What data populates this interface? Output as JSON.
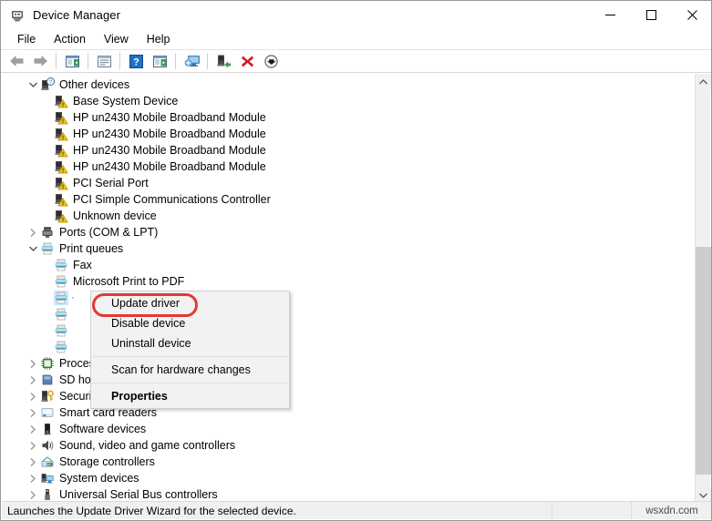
{
  "window": {
    "title": "Device Manager",
    "icon": "device-manager-icon",
    "buttons": {
      "minimize": "—",
      "maximize": "□",
      "close": "✕"
    }
  },
  "menubar": {
    "items": [
      {
        "label": "File",
        "name": "menu-file"
      },
      {
        "label": "Action",
        "name": "menu-action"
      },
      {
        "label": "View",
        "name": "menu-view"
      },
      {
        "label": "Help",
        "name": "menu-help"
      }
    ]
  },
  "toolbar": {
    "buttons": [
      {
        "name": "back-button",
        "icon": "back-arrow-icon",
        "title": "Back"
      },
      {
        "name": "forward-button",
        "icon": "forward-arrow-icon",
        "title": "Forward"
      },
      {
        "name": "show-hide-console-tree-button",
        "icon": "console-tree-icon",
        "title": "Show/Hide Console Tree"
      },
      {
        "name": "properties-button",
        "icon": "properties-window-icon",
        "title": "Properties"
      },
      {
        "name": "help-button",
        "icon": "question-mark-icon",
        "title": "Help"
      },
      {
        "name": "action-pane-button",
        "icon": "action-pane-icon",
        "title": "Show Action Pane"
      },
      {
        "name": "scan-hardware-changes-button",
        "icon": "scan-monitor-icon",
        "title": "Scan for hardware changes"
      },
      {
        "name": "update-driver-button",
        "icon": "update-driver-icon",
        "title": "Update driver"
      },
      {
        "name": "uninstall-device-button",
        "icon": "red-x-icon",
        "title": "Uninstall device"
      },
      {
        "name": "disable-device-button",
        "icon": "down-arrow-circle-icon",
        "title": "Disable device"
      }
    ]
  },
  "tree": {
    "rows": [
      {
        "label": "Other devices",
        "level": 0,
        "expander": "expanded",
        "icon": "unknown-device-category-icon",
        "selected": false
      },
      {
        "label": "Base System Device",
        "level": 1,
        "expander": "none",
        "icon": "warning-device-icon",
        "selected": false
      },
      {
        "label": "HP un2430 Mobile Broadband Module",
        "level": 1,
        "expander": "none",
        "icon": "warning-device-icon",
        "selected": false
      },
      {
        "label": "HP un2430 Mobile Broadband Module",
        "level": 1,
        "expander": "none",
        "icon": "warning-device-icon",
        "selected": false
      },
      {
        "label": "HP un2430 Mobile Broadband Module",
        "level": 1,
        "expander": "none",
        "icon": "warning-device-icon",
        "selected": false
      },
      {
        "label": "HP un2430 Mobile Broadband Module",
        "level": 1,
        "expander": "none",
        "icon": "warning-device-icon",
        "selected": false
      },
      {
        "label": "PCI Serial Port",
        "level": 1,
        "expander": "none",
        "icon": "warning-device-icon",
        "selected": false
      },
      {
        "label": "PCI Simple Communications Controller",
        "level": 1,
        "expander": "none",
        "icon": "warning-device-icon",
        "selected": false
      },
      {
        "label": "Unknown device",
        "level": 1,
        "expander": "none",
        "icon": "warning-device-icon",
        "selected": false
      },
      {
        "label": "Ports (COM & LPT)",
        "level": 0,
        "expander": "collapsed",
        "icon": "port-icon",
        "selected": false
      },
      {
        "label": "Print queues",
        "level": 0,
        "expander": "expanded",
        "icon": "printer-icon",
        "selected": false
      },
      {
        "label": "Fax",
        "level": 1,
        "expander": "none",
        "icon": "printer-icon",
        "selected": false
      },
      {
        "label": "Microsoft Print to PDF",
        "level": 1,
        "expander": "none",
        "icon": "printer-icon",
        "selected": false
      },
      {
        "label": "",
        "level": 1,
        "expander": "none",
        "icon": "printer-icon",
        "selected": true
      },
      {
        "label": "",
        "level": 1,
        "expander": "none",
        "icon": "printer-icon",
        "selected": false
      },
      {
        "label": "",
        "level": 1,
        "expander": "none",
        "icon": "printer-icon",
        "selected": false
      },
      {
        "label": "",
        "level": 1,
        "expander": "none",
        "icon": "printer-icon",
        "selected": false
      },
      {
        "label": "Processors",
        "level": 0,
        "expander": "collapsed",
        "icon": "processor-icon",
        "selected": false
      },
      {
        "label": "SD host adapters",
        "level": 0,
        "expander": "collapsed",
        "icon": "sd-host-icon",
        "selected": false
      },
      {
        "label": "Security devices",
        "level": 0,
        "expander": "collapsed",
        "icon": "security-device-icon",
        "selected": false
      },
      {
        "label": "Smart card readers",
        "level": 0,
        "expander": "collapsed",
        "icon": "smartcard-reader-icon",
        "selected": false
      },
      {
        "label": "Software devices",
        "level": 0,
        "expander": "collapsed",
        "icon": "software-device-icon",
        "selected": false
      },
      {
        "label": "Sound, video and game controllers",
        "level": 0,
        "expander": "collapsed",
        "icon": "speaker-icon",
        "selected": false
      },
      {
        "label": "Storage controllers",
        "level": 0,
        "expander": "collapsed",
        "icon": "storage-controller-icon",
        "selected": false
      },
      {
        "label": "System devices",
        "level": 0,
        "expander": "collapsed",
        "icon": "system-device-icon",
        "selected": false
      },
      {
        "label": "Universal Serial Bus controllers",
        "level": 0,
        "expander": "collapsed",
        "icon": "usb-icon",
        "selected": false
      }
    ]
  },
  "context_menu": {
    "items": [
      {
        "label": "Update driver",
        "name": "ctx-update-driver",
        "bold": false,
        "separator_after": false,
        "highlighted": true
      },
      {
        "label": "Disable device",
        "name": "ctx-disable-device",
        "bold": false,
        "separator_after": false,
        "highlighted": false
      },
      {
        "label": "Uninstall device",
        "name": "ctx-uninstall-device",
        "bold": false,
        "separator_after": true,
        "highlighted": false
      },
      {
        "label": "Scan for hardware changes",
        "name": "ctx-scan-hardware",
        "bold": false,
        "separator_after": true,
        "highlighted": false
      },
      {
        "label": "Properties",
        "name": "ctx-properties",
        "bold": true,
        "separator_after": false,
        "highlighted": false
      }
    ],
    "highlight_color": "#e03a32"
  },
  "statusbar": {
    "text": "Launches the Update Driver Wizard for the selected device.",
    "watermark": "wsxdn.com"
  },
  "scrollbar": {
    "up_arrow": "▲",
    "down_arrow": "▼"
  },
  "colors": {
    "selection": "#cce8ff",
    "accent_red": "#e03a32",
    "toolbar_bg": "#ffffff",
    "status_bg": "#f0f0f0"
  }
}
